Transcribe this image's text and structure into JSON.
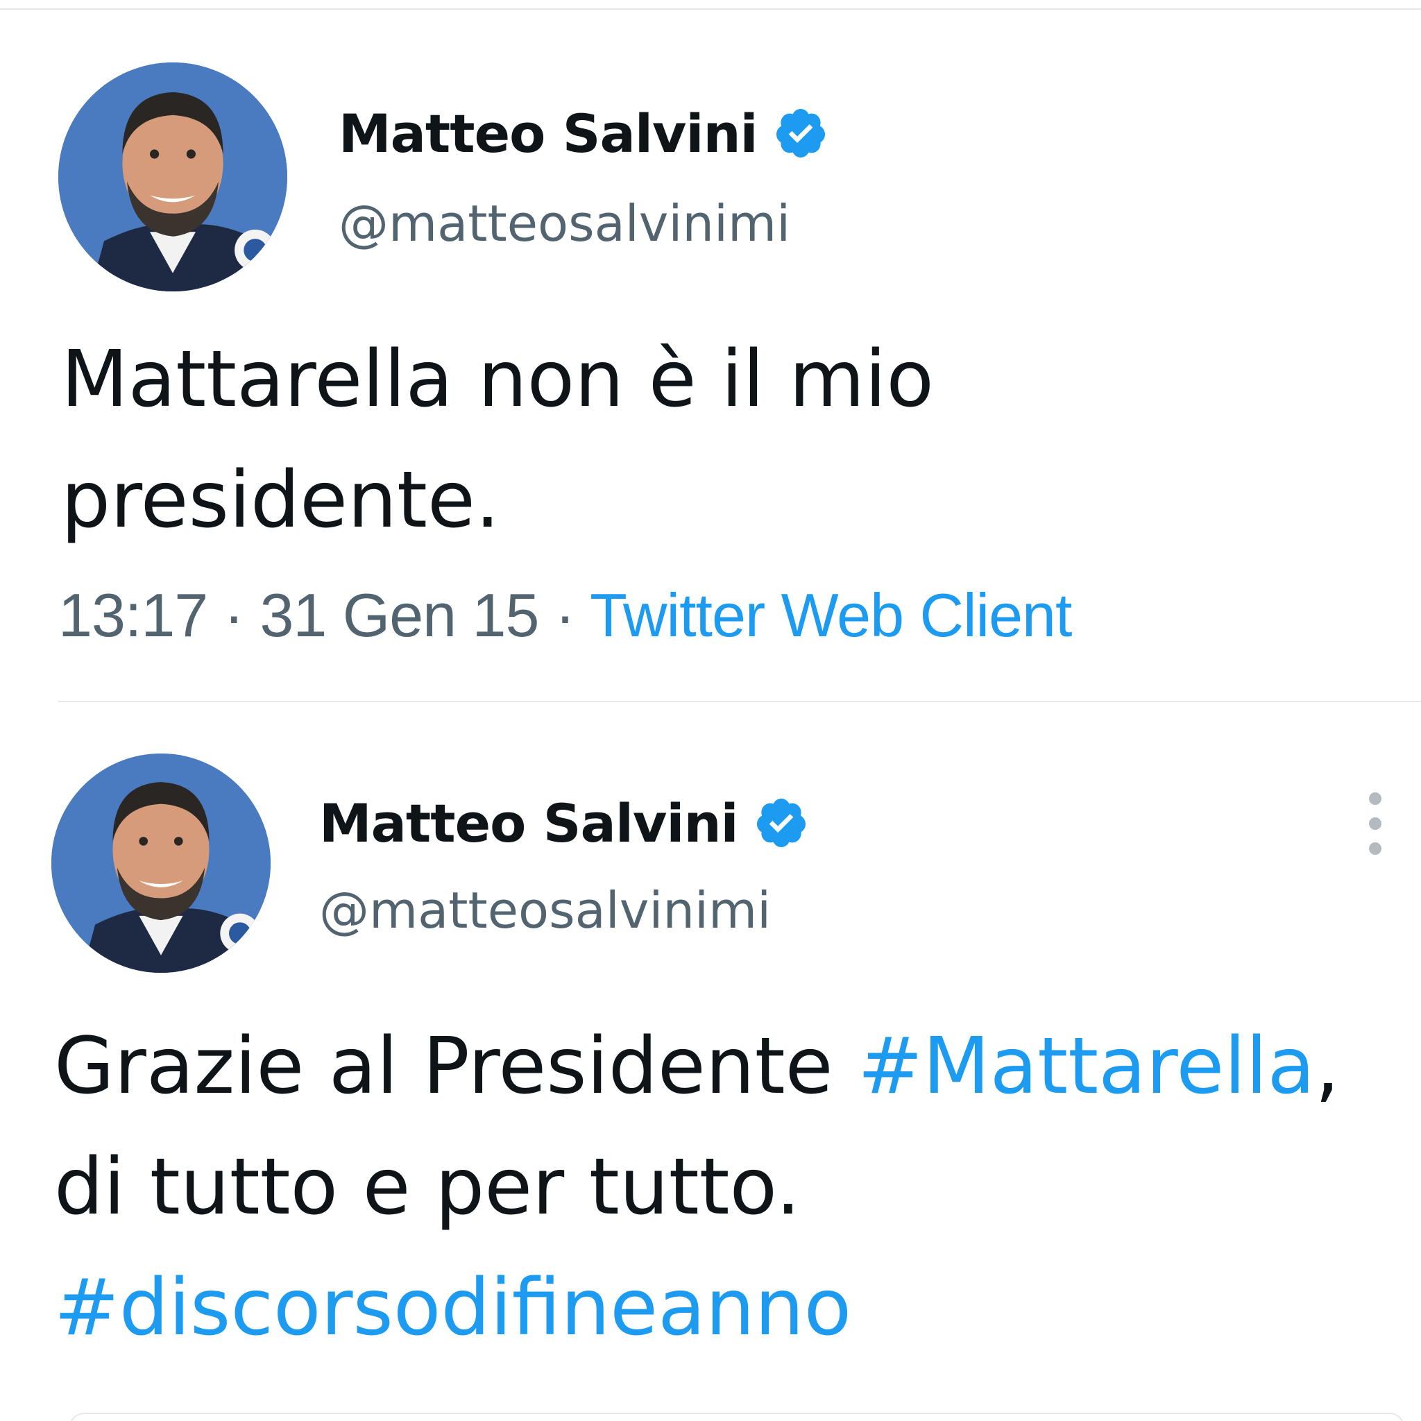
{
  "tweets": [
    {
      "author": {
        "display_name": "Matteo Salvini",
        "handle": "@matteosalvinimi",
        "verified_icon": "verified-badge-icon",
        "avatar": "profile-photo"
      },
      "text_lines": [
        "Mattarella non è il mio",
        "presidente."
      ],
      "meta": {
        "time": "13:17",
        "separator": "·",
        "date": "31 Gen 15",
        "client": "Twitter Web Client"
      }
    },
    {
      "author": {
        "display_name": "Matteo Salvini",
        "handle": "@matteosalvinimi",
        "verified_icon": "verified-badge-icon",
        "avatar": "profile-photo"
      },
      "text": {
        "line1_prefix": "Grazie al Presidente ",
        "line1_hashtag": "#Mattarella",
        "line1_suffix": ",",
        "line2": "di tutto e per tutto.",
        "line3_hashtag": "#discorsodifineanno"
      },
      "more_icon": "more-vertical-icon"
    }
  ],
  "colors": {
    "text": "#0f1419",
    "secondary": "#536471",
    "accent": "#1d9bf0",
    "divider": "#e6e9eb"
  }
}
